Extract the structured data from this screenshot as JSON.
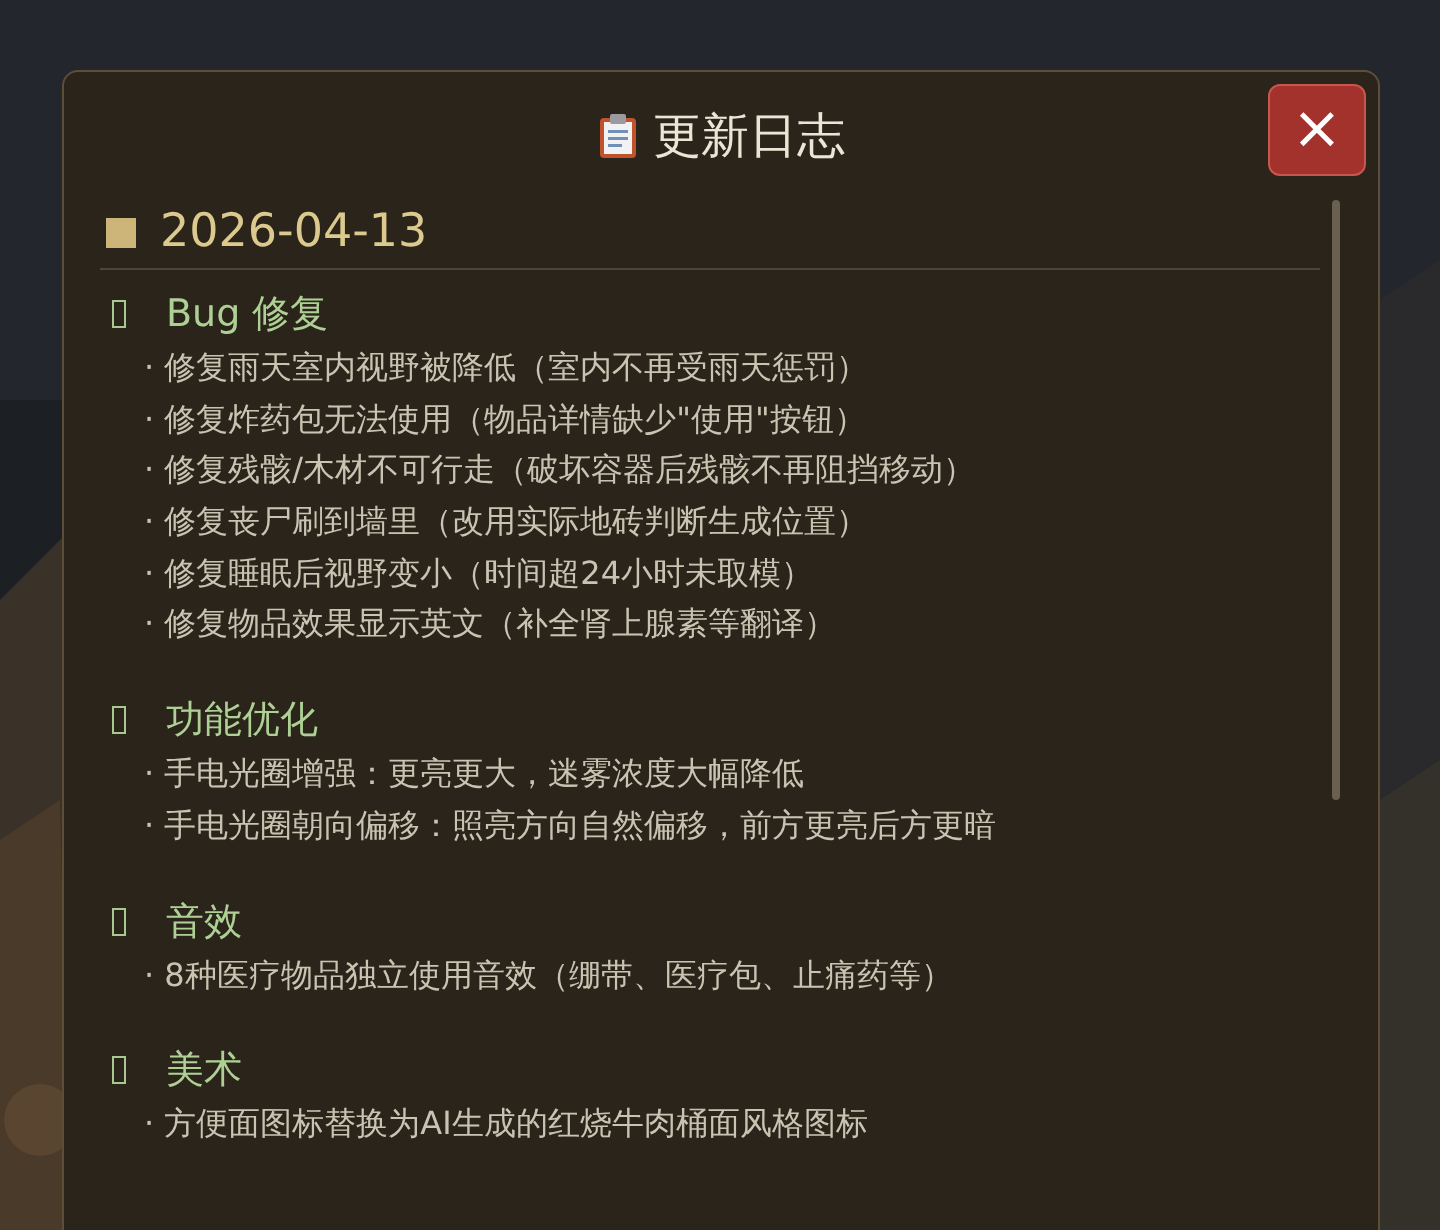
{
  "dialog": {
    "title": "更新日志",
    "close_label": "×"
  },
  "entries": [
    {
      "date": "2026-04-13",
      "sections": [
        {
          "heading": "Bug 修复",
          "items": [
            "· 修复雨天室内视野被降低（室内不再受雨天惩罚）",
            "· 修复炸药包无法使用（物品详情缺少\"使用\"按钮）",
            "· 修复残骸/木材不可行走（破坏容器后残骸不再阻挡移动）",
            "· 修复丧尸刷到墙里（改用实际地砖判断生成位置）",
            "· 修复睡眠后视野变小（时间超24小时未取模）",
            "· 修复物品效果显示英文（补全肾上腺素等翻译）"
          ]
        },
        {
          "heading": "功能优化",
          "items": [
            "· 手电光圈增强：更亮更大，迷雾浓度大幅降低",
            "· 手电光圈朝向偏移：照亮方向自然偏移，前方更亮后方更暗"
          ]
        },
        {
          "heading": "音效",
          "items": [
            "· 8种医疗物品独立使用音效（绷带、医疗包、止痛药等）"
          ]
        },
        {
          "heading": "美术",
          "items": [
            "· 方便面图标替换为AI生成的红烧牛肉桶面风格图标"
          ]
        }
      ]
    }
  ]
}
